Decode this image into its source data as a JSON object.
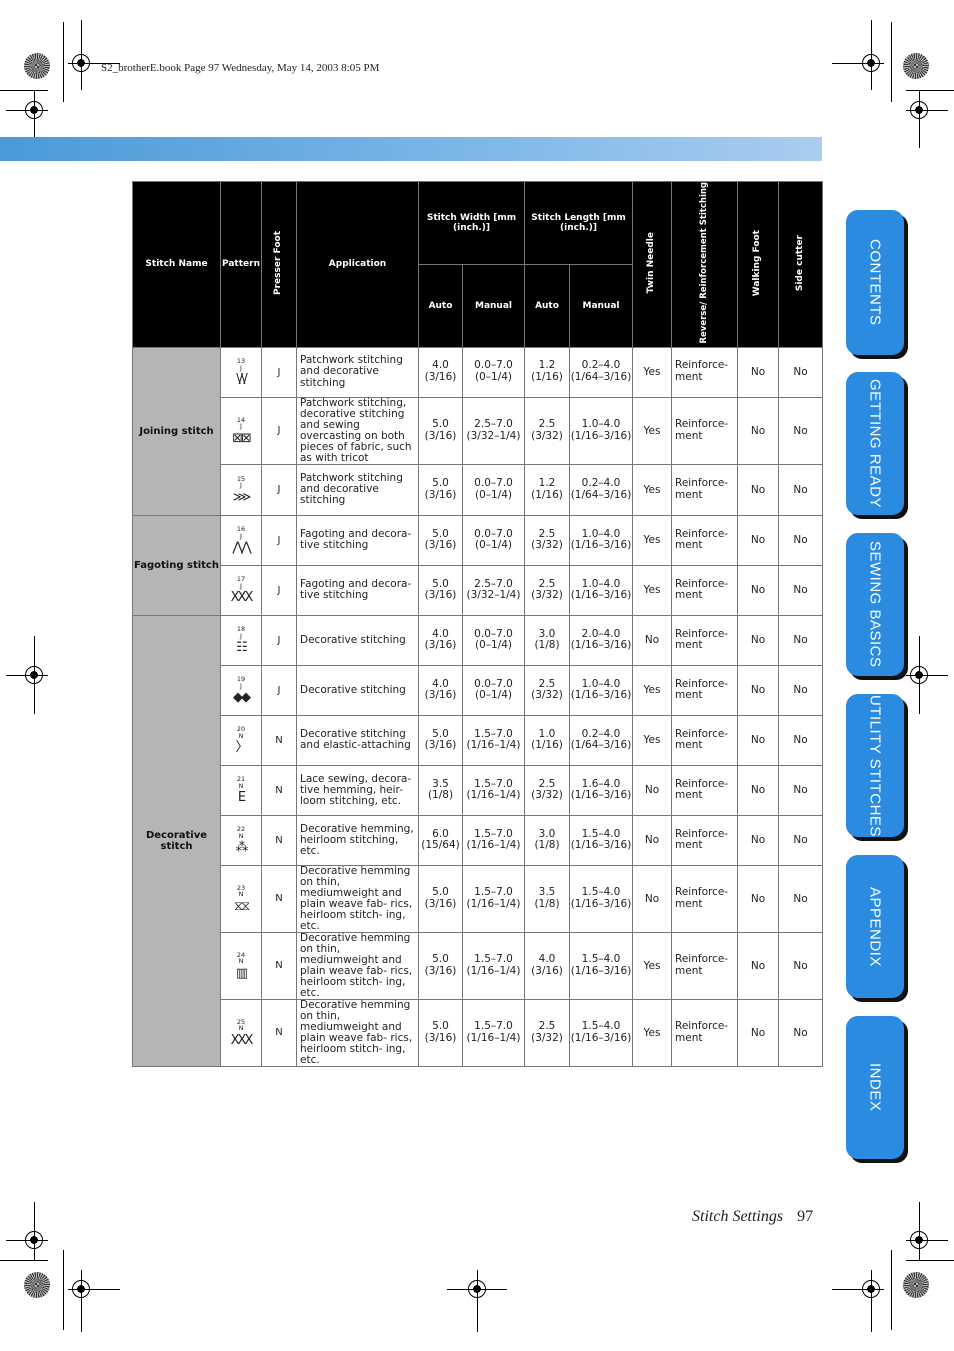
{
  "header": {
    "print_info": "S2_brotherE.book  Page 97  Wednesday, May 14, 2003  8:05 PM"
  },
  "table": {
    "headers": {
      "stitch_name": "Stitch Name",
      "pattern": "Pattern",
      "presser_foot": "Presser Foot",
      "application": "Application",
      "stitch_width": "Stitch Width [mm (inch.)]",
      "stitch_length": "Stitch Length [mm (inch.)]",
      "auto": "Auto",
      "manual": "Manual",
      "twin_needle": "Twin Needle",
      "reverse": "Reverse/ Reinforcement Stitching",
      "walking_foot": "Walking Foot",
      "side_cutter": "Side cutter"
    },
    "groups": [
      {
        "name": "Joining stitch"
      },
      {
        "name": "Fagoting stitch"
      },
      {
        "name": "Decorative stitch"
      }
    ],
    "rows": [
      {
        "pattern_num": "13",
        "foot": "J",
        "glyph": "\\/\\/",
        "application": "Patchwork stitching and decorative stitching",
        "w_auto": "4.0",
        "w_auto_in": "(3/16)",
        "w_man": "0.0–7.0",
        "w_man_in": "(0–1/4)",
        "l_auto": "1.2",
        "l_auto_in": "(1/16)",
        "l_man": "0.2–4.0",
        "l_man_in": "(1/64–3/16)",
        "twin": "Yes",
        "reverse": "Reinforce- ment",
        "walking": "No",
        "cutter": "No"
      },
      {
        "pattern_num": "14",
        "foot": "J",
        "glyph": "⊠⊠",
        "application": "Patchwork stitching, decorative stitching and sewing overcasting on both pieces of fabric, such as with tricot",
        "w_auto": "5.0",
        "w_auto_in": "(3/16)",
        "w_man": "2.5–7.0",
        "w_man_in": "(3/32–1/4)",
        "l_auto": "2.5",
        "l_auto_in": "(3/32)",
        "l_man": "1.0–4.0",
        "l_man_in": "(1/16–3/16)",
        "twin": "Yes",
        "reverse": "Reinforce- ment",
        "walking": "No",
        "cutter": "No"
      },
      {
        "pattern_num": "15",
        "foot": "J",
        "glyph": "⋙",
        "application": "Patchwork stitching and decorative stitching",
        "w_auto": "5.0",
        "w_auto_in": "(3/16)",
        "w_man": "0.0–7.0",
        "w_man_in": "(0–1/4)",
        "l_auto": "1.2",
        "l_auto_in": "(1/16)",
        "l_man": "0.2–4.0",
        "l_man_in": "(1/64–3/16)",
        "twin": "Yes",
        "reverse": "Reinforce- ment",
        "walking": "No",
        "cutter": "No"
      },
      {
        "pattern_num": "16",
        "foot": "J",
        "glyph": "⋀⋀",
        "application": "Fagoting and decora- tive stitching",
        "w_auto": "5.0",
        "w_auto_in": "(3/16)",
        "w_man": "0.0–7.0",
        "w_man_in": "(0–1/4)",
        "l_auto": "2.5",
        "l_auto_in": "(3/32)",
        "l_man": "1.0–4.0",
        "l_man_in": "(1/16–3/16)",
        "twin": "Yes",
        "reverse": "Reinforce- ment",
        "walking": "No",
        "cutter": "No"
      },
      {
        "pattern_num": "17",
        "foot": "J",
        "glyph": "XXX",
        "application": "Fagoting and decora- tive stitching",
        "w_auto": "5.0",
        "w_auto_in": "(3/16)",
        "w_man": "2.5–7.0",
        "w_man_in": "(3/32–1/4)",
        "l_auto": "2.5",
        "l_auto_in": "(3/32)",
        "l_man": "1.0–4.0",
        "l_man_in": "(1/16–3/16)",
        "twin": "Yes",
        "reverse": "Reinforce- ment",
        "walking": "No",
        "cutter": "No"
      },
      {
        "pattern_num": "18",
        "foot": "J",
        "glyph": "☷",
        "application": "Decorative stitching",
        "w_auto": "4.0",
        "w_auto_in": "(3/16)",
        "w_man": "0.0–7.0",
        "w_man_in": "(0–1/4)",
        "l_auto": "3.0",
        "l_auto_in": "(1/8)",
        "l_man": "2.0–4.0",
        "l_man_in": "(1/16–3/16)",
        "twin": "No",
        "reverse": "Reinforce- ment",
        "walking": "No",
        "cutter": "No"
      },
      {
        "pattern_num": "19",
        "foot": "J",
        "glyph": "◆◆",
        "application": "Decorative stitching",
        "w_auto": "4.0",
        "w_auto_in": "(3/16)",
        "w_man": "0.0–7.0",
        "w_man_in": "(0–1/4)",
        "l_auto": "2.5",
        "l_auto_in": "(3/32)",
        "l_man": "1.0–4.0",
        "l_man_in": "(1/16–3/16)",
        "twin": "Yes",
        "reverse": "Reinforce- ment",
        "walking": "No",
        "cutter": "No"
      },
      {
        "pattern_num": "20",
        "foot": "N",
        "glyph": "〉",
        "application": "Decorative stitching and elastic-attaching",
        "w_auto": "5.0",
        "w_auto_in": "(3/16)",
        "w_man": "1.5–7.0",
        "w_man_in": "(1/16–1/4)",
        "l_auto": "1.0",
        "l_auto_in": "(1/16)",
        "l_man": "0.2–4.0",
        "l_man_in": "(1/64–3/16)",
        "twin": "Yes",
        "reverse": "Reinforce- ment",
        "walking": "No",
        "cutter": "No"
      },
      {
        "pattern_num": "21",
        "foot": "N",
        "glyph": "Ε",
        "application": "Lace sewing, decora- tive hemming, heir- loom stitching, etc.",
        "w_auto": "3.5",
        "w_auto_in": "(1/8)",
        "w_man": "1.5–7.0",
        "w_man_in": "(1/16–1/4)",
        "l_auto": "2.5",
        "l_auto_in": "(3/32)",
        "l_man": "1.6–4.0",
        "l_man_in": "(1/16–3/16)",
        "twin": "No",
        "reverse": "Reinforce- ment",
        "walking": "No",
        "cutter": "No"
      },
      {
        "pattern_num": "22",
        "foot": "N",
        "glyph": "⁂",
        "application": "Decorative hemming, heirloom stitching, etc.",
        "w_auto": "6.0",
        "w_auto_in": "(15/64)",
        "w_man": "1.5–7.0",
        "w_man_in": "(1/16–1/4)",
        "l_auto": "3.0",
        "l_auto_in": "(1/8)",
        "l_man": "1.5–4.0",
        "l_man_in": "(1/16–3/16)",
        "twin": "No",
        "reverse": "Reinforce- ment",
        "walking": "No",
        "cutter": "No"
      },
      {
        "pattern_num": "23",
        "foot": "N",
        "glyph": "⧖⧖",
        "application": "Decorative hemming on thin, mediumweight and plain weave fab- rics, heirloom stitch- ing, etc.",
        "w_auto": "5.0",
        "w_auto_in": "(3/16)",
        "w_man": "1.5–7.0",
        "w_man_in": "(1/16–1/4)",
        "l_auto": "3.5",
        "l_auto_in": "(1/8)",
        "l_man": "1.5–4.0",
        "l_man_in": "(1/16–3/16)",
        "twin": "No",
        "reverse": "Reinforce- ment",
        "walking": "No",
        "cutter": "No"
      },
      {
        "pattern_num": "24",
        "foot": "N",
        "glyph": "▥",
        "application": "Decorative hemming on thin, mediumweight and plain weave fab- rics, heirloom stitch- ing, etc.",
        "w_auto": "5.0",
        "w_auto_in": "(3/16)",
        "w_man": "1.5–7.0",
        "w_man_in": "(1/16–1/4)",
        "l_auto": "4.0",
        "l_auto_in": "(3/16)",
        "l_man": "1.5–4.0",
        "l_man_in": "(1/16–3/16)",
        "twin": "Yes",
        "reverse": "Reinforce- ment",
        "walking": "No",
        "cutter": "No"
      },
      {
        "pattern_num": "25",
        "foot": "N",
        "glyph": "XXX",
        "application": "Decorative hemming on thin, mediumweight and plain weave fab- rics, heirloom stitch- ing, etc.",
        "w_auto": "5.0",
        "w_auto_in": "(3/16)",
        "w_man": "1.5–7.0",
        "w_man_in": "(1/16–1/4)",
        "l_auto": "2.5",
        "l_auto_in": "(3/32)",
        "l_man": "1.5–4.0",
        "l_man_in": "(1/16–3/16)",
        "twin": "Yes",
        "reverse": "Reinforce- ment",
        "walking": "No",
        "cutter": "No"
      }
    ]
  },
  "side_tabs": [
    "CONTENTS",
    "GETTING READY",
    "SEWING BASICS",
    "UTILITY STITCHES",
    "APPENDIX",
    "INDEX"
  ],
  "footer": {
    "section_title": "Stitch Settings",
    "page_number": "97"
  },
  "colors": {
    "tab_blue": "#2a8be0",
    "group_gray": "#b5b5b5",
    "header_black": "#000000"
  }
}
